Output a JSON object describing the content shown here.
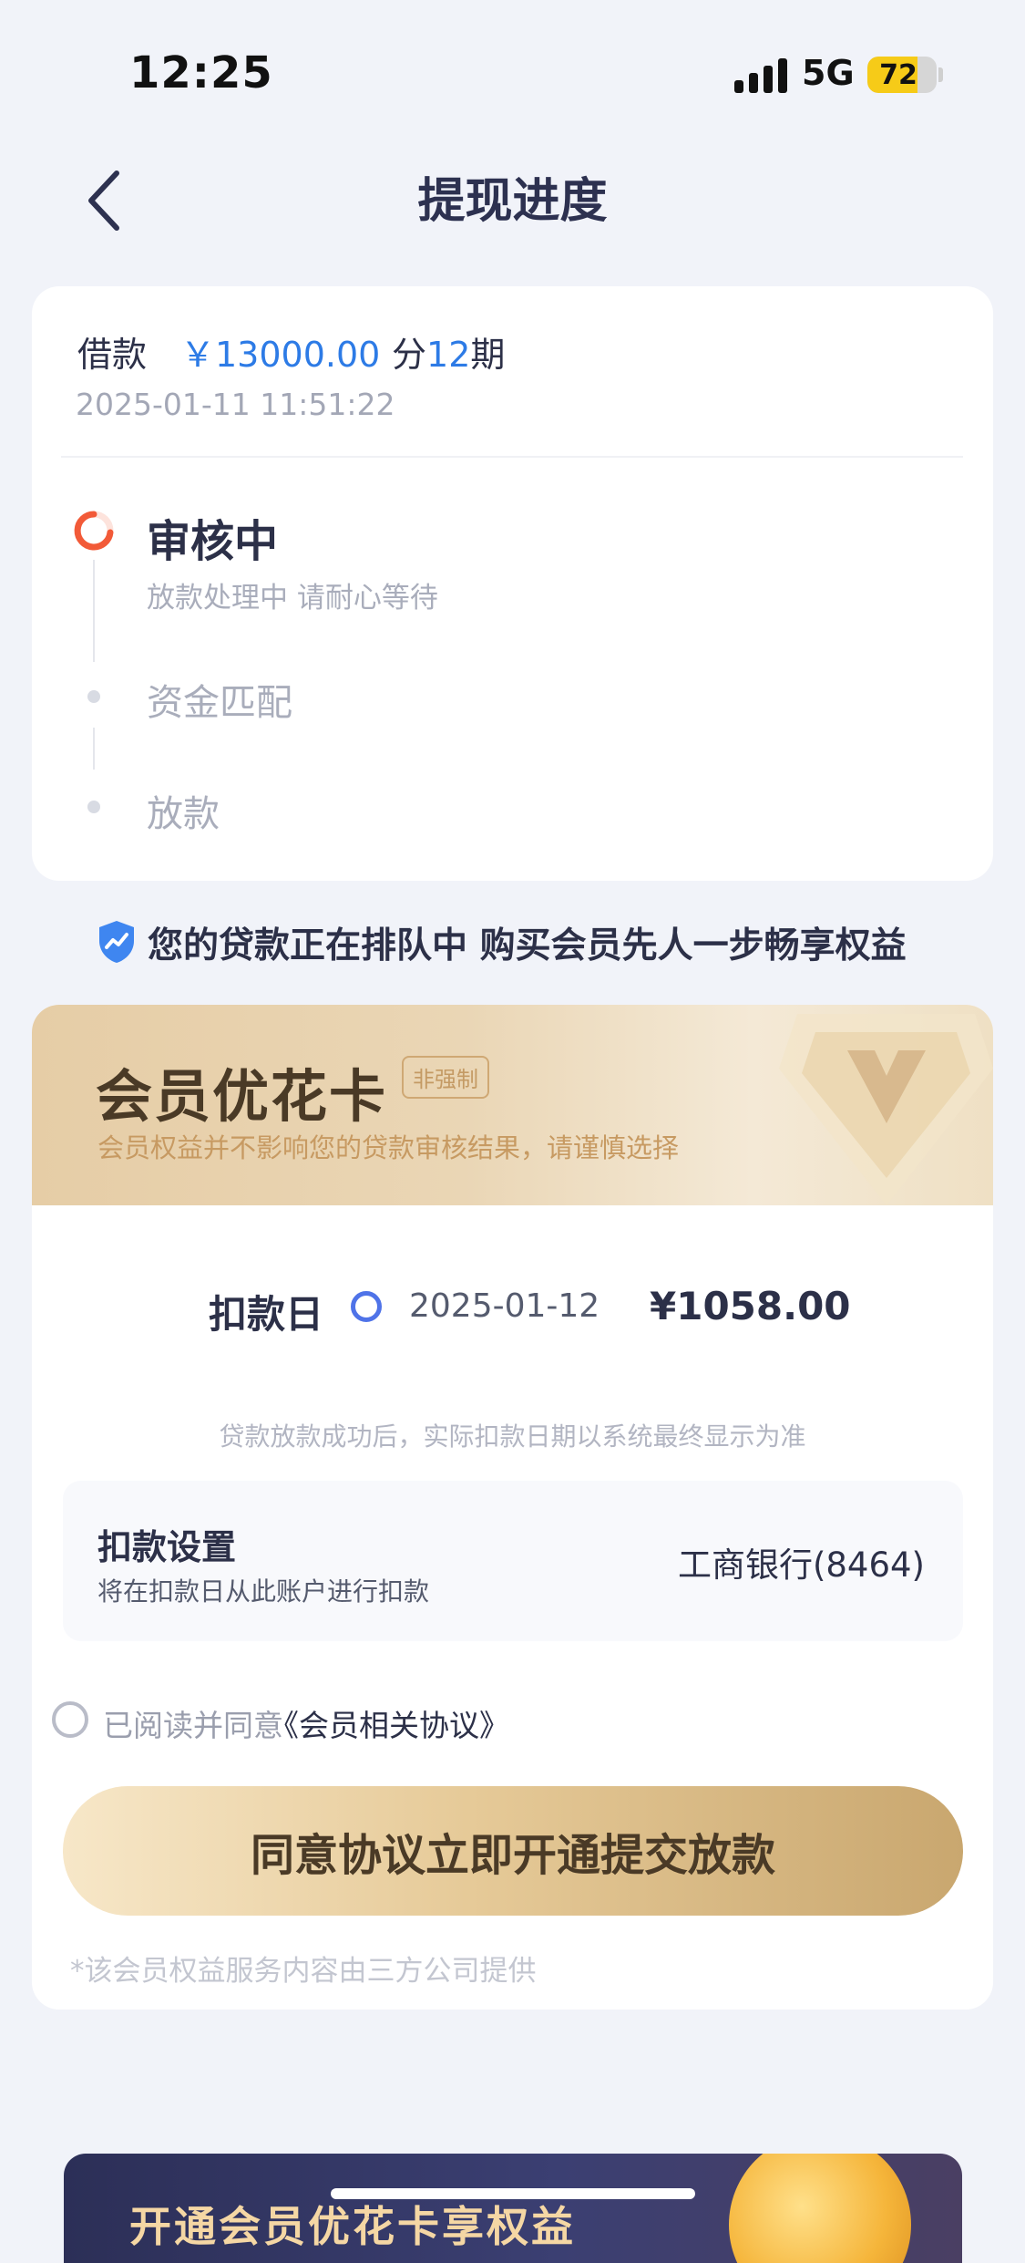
{
  "status_bar": {
    "time": "12:25",
    "network": "5G",
    "battery": "72",
    "battery_level": 0.72
  },
  "nav": {
    "title": "提现进度"
  },
  "loan": {
    "label": "借款",
    "amount": "￥13000.00",
    "terms_prefix": "分",
    "terms_count": "12",
    "terms_suffix": "期",
    "date": "2025-01-11 11:51:22"
  },
  "progress": {
    "current": {
      "title": "审核中",
      "subtitle": "放款处理中 请耐心等待"
    },
    "step2": "资金匹配",
    "step3": "放款"
  },
  "queue_notice": "您的贷款正在排队中 购买会员先人一步畅享权益",
  "membership": {
    "title": "会员优花卡",
    "tag": "非强制",
    "subtitle": "会员权益并不影响您的贷款审核结果，请谨慎选择",
    "deduct_label": "扣款日",
    "deduct_date": "2025-01-12",
    "deduct_amount": "¥1058.00",
    "deduct_note": "贷款放款成功后，实际扣款日期以系统最终显示为准",
    "settings_title": "扣款设置",
    "settings_subtitle": "将在扣款日从此账户进行扣款",
    "bank": "工商银行(8464)",
    "agree_text": "已阅读并同意",
    "agree_link": "《会员相关协议》",
    "cta": "同意协议立即开通提交放款",
    "footnote": "*该会员权益服务内容由三方公司提供"
  },
  "promo": {
    "text": "开通会员优花卡享权益"
  },
  "colors": {
    "accent_blue": "#2d7be6",
    "status_red": "#f25a38",
    "gold": "#c9a76f",
    "radio_blue": "#4f73e8"
  }
}
